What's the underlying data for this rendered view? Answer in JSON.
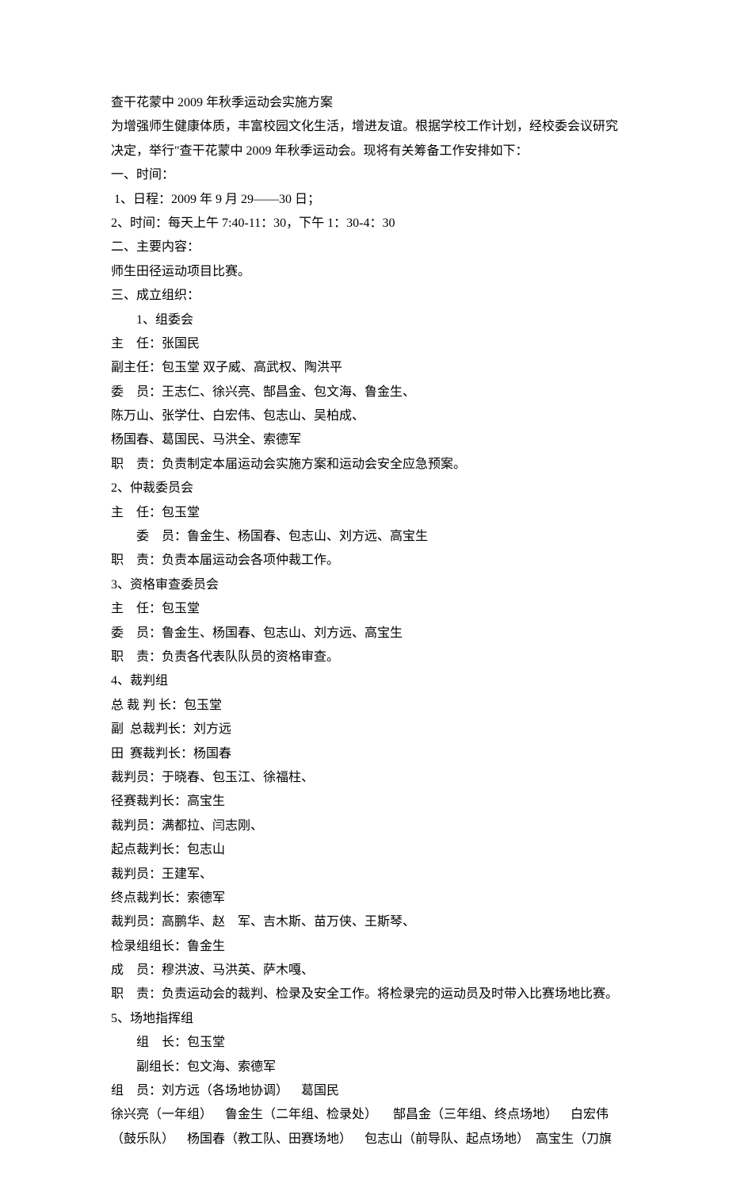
{
  "lines": [
    {
      "text": "查干花蒙中 2009 年秋季运动会实施方案"
    },
    {
      "text": "为增强师生健康体质，丰富校园文化生活，增进友谊。根据学校工作计划，经校委会议研究决定，举行\"查干花蒙中 2009 年秋季运动会。现将有关筹备工作安排如下："
    },
    {
      "text": "一、时间："
    },
    {
      "text": " 1、日程：2009 年 9 月 29——30 日；"
    },
    {
      "text": "2、时间：每天上午 7:40-11：30，下午 1：30-4：30"
    },
    {
      "text": "二、主要内容："
    },
    {
      "text": "师生田径运动项目比赛。"
    },
    {
      "text": "三、成立组织："
    },
    {
      "text": "1、组委会",
      "cls": "indent1"
    },
    {
      "text": "主    任：张国民"
    },
    {
      "text": "副主任：包玉堂 双子威、高武权、陶洪平"
    },
    {
      "text": "委    员：王志仁、徐兴亮、郜昌金、包文海、鲁金生、"
    },
    {
      "text": "陈万山、张学仕、白宏伟、包志山、吴柏成、"
    },
    {
      "text": "杨国春、葛国民、马洪全、索德军"
    },
    {
      "text": "职    责：负责制定本届运动会实施方案和运动会安全应急预案。"
    },
    {
      "text": "2、仲裁委员会"
    },
    {
      "text": "主    任：包玉堂"
    },
    {
      "text": "委    员：鲁金生、杨国春、包志山、刘方远、高宝生",
      "cls": "indent1"
    },
    {
      "text": "职    责：负责本届运动会各项仲裁工作。"
    },
    {
      "text": "3、资格审查委员会"
    },
    {
      "text": "主    任：包玉堂"
    },
    {
      "text": "委    员：鲁金生、杨国春、包志山、刘方远、高宝生"
    },
    {
      "text": "职    责：负责各代表队队员的资格审查。"
    },
    {
      "text": "4、裁判组"
    },
    {
      "text": "总 裁 判 长：包玉堂"
    },
    {
      "text": "副  总裁判长：刘方远"
    },
    {
      "text": "田  赛裁判长：杨国春"
    },
    {
      "text": "裁判员：于晓春、包玉江、徐福柱、"
    },
    {
      "text": "径赛裁判长：高宝生"
    },
    {
      "text": "裁判员：满都拉、闫志刚、"
    },
    {
      "text": "起点裁判长：包志山"
    },
    {
      "text": "裁判员：王建军、"
    },
    {
      "text": "终点裁判长：索德军"
    },
    {
      "text": "裁判员：高鹏华、赵    军、吉木斯、苗万侠、王斯琴、"
    },
    {
      "text": "检录组组长：鲁金生"
    },
    {
      "text": "成    员：穆洪波、马洪英、萨木嘎、"
    },
    {
      "text": "职    责：负责运动会的裁判、检录及安全工作。将检录完的运动员及时带入比赛场地比赛。"
    },
    {
      "text": "5、场地指挥组"
    },
    {
      "text": "组    长：包玉堂",
      "cls": "indent1"
    },
    {
      "text": "副组长：包文海、索德军",
      "cls": "indent1"
    },
    {
      "text": "组    员：刘方远（各场地协调）    葛国民"
    },
    {
      "text": "徐兴亮（一年组）    鲁金生（二年组、检录处）     郜昌金（三年组、终点场地）    白宏伟（鼓乐队）    杨国春（教工队、田赛场地）    包志山（前导队、起点场地）  高宝生（刀旗"
    }
  ]
}
